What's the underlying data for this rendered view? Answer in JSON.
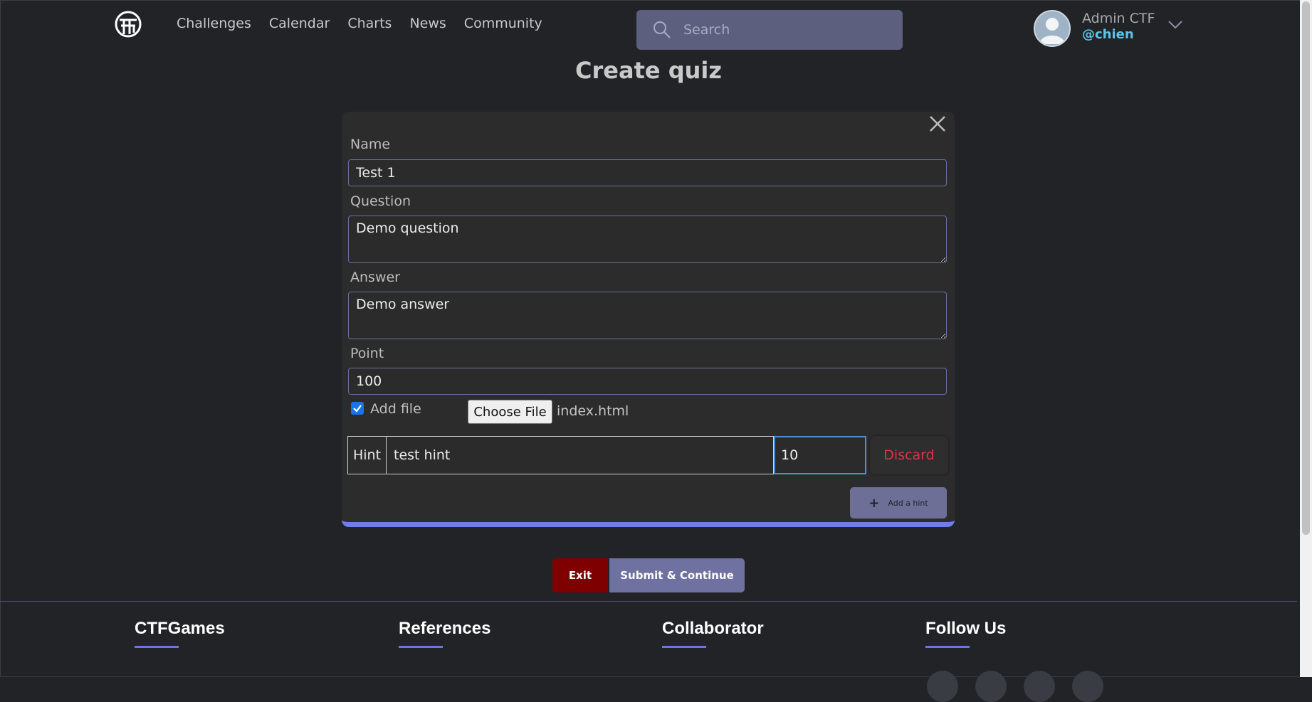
{
  "header": {
    "nav": [
      "Challenges",
      "Calendar",
      "Charts",
      "News",
      "Community"
    ],
    "search_placeholder": "Search",
    "user_name": "Admin CTF",
    "user_handle": "@chien"
  },
  "page": {
    "title": "Create quiz"
  },
  "form": {
    "name_label": "Name",
    "name_value": "Test 1",
    "question_label": "Question",
    "question_value": "Demo question",
    "answer_label": "Answer",
    "answer_value": "Demo answer",
    "point_label": "Point",
    "point_value": "100",
    "add_file_label": "Add file",
    "add_file_checked": true,
    "choose_file_label": "Choose File",
    "file_name": "index.html",
    "hint": {
      "tag": "Hint",
      "text": "test hint",
      "points": "10",
      "discard_label": "Discard"
    },
    "add_hint_label": "Add a hint"
  },
  "actions": {
    "exit_label": "Exit",
    "submit_label": "Submit & Continue"
  },
  "footer": {
    "columns": [
      {
        "title": "CTFGames"
      },
      {
        "title": "References"
      },
      {
        "title": "Collaborator"
      },
      {
        "title": "Follow Us"
      }
    ]
  },
  "colors": {
    "background": "#212327",
    "accent": "#6f75e0",
    "danger": "#dc3545",
    "exit": "#7e0000"
  }
}
